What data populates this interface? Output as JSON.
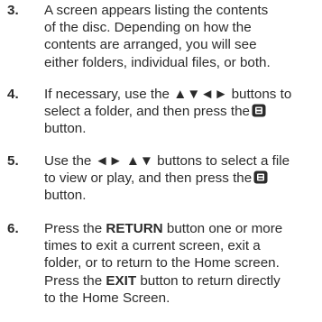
{
  "steps": [
    {
      "number": "3.",
      "lines": [
        "A screen appears listing the contents",
        "of the disc. Depending on how the",
        "contents are arranged, you will see",
        "either folders, individual files, or both."
      ]
    },
    {
      "number": "4.",
      "line1": "If necessary, use the ▲▼◄► buttons to",
      "line2_pre": "select a folder, and then press the",
      "line3": "button.",
      "icon": "enter-button-icon"
    },
    {
      "number": "5.",
      "line1": "Use the ◄► ▲▼ buttons to select a file",
      "line2_pre": "to view or play, and then press the",
      "line3": "button.",
      "icon": "enter-button-icon"
    },
    {
      "number": "6.",
      "l1_pre": "Press the ",
      "l1_bold": "RETURN",
      "l1_post": " button one or more",
      "l2": "times to exit a current screen, exit a",
      "l3": "folder, or to return to the Home screen.",
      "l4_pre": "Press the ",
      "l4_bold": "EXIT",
      "l4_post": " button to return directly",
      "l5": "to the Home Screen."
    }
  ]
}
